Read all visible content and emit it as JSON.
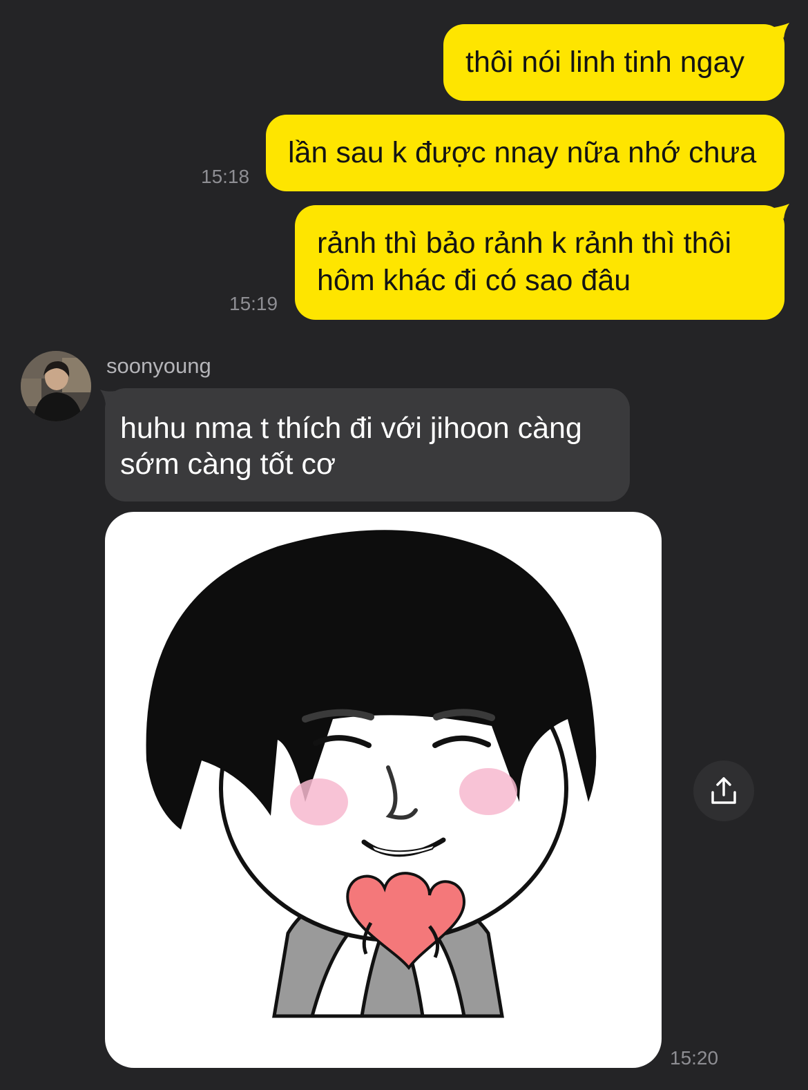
{
  "messages_out": [
    {
      "text_lines": [
        "thôi nói linh tinh ngay"
      ],
      "time": ""
    },
    {
      "text_lines": [
        "lần sau k được nnay nữa nhớ chưa"
      ],
      "time": "15:18"
    },
    {
      "text_lines": [
        "rảnh thì bảo rảnh k rảnh thì thôi",
        "hôm khác đi có sao đâu"
      ],
      "time": "15:19"
    }
  ],
  "incoming": {
    "sender": "soonyoung",
    "text_lines": [
      "huhu nma t thích đi với jihoon càng",
      "sớm càng tốt cơ"
    ],
    "sticker_time": "15:20"
  },
  "icons": {
    "share": "share-upload-icon",
    "avatar": "avatar-photo",
    "sticker": "sticker-image-bowl-cut-heart"
  },
  "colors": {
    "background": "#242426",
    "outgoing_bubble": "#fee500",
    "incoming_bubble": "#3a3a3c",
    "timestamp": "#8e8e93",
    "heart": "#f4787a",
    "blush": "#f7b9cf"
  }
}
